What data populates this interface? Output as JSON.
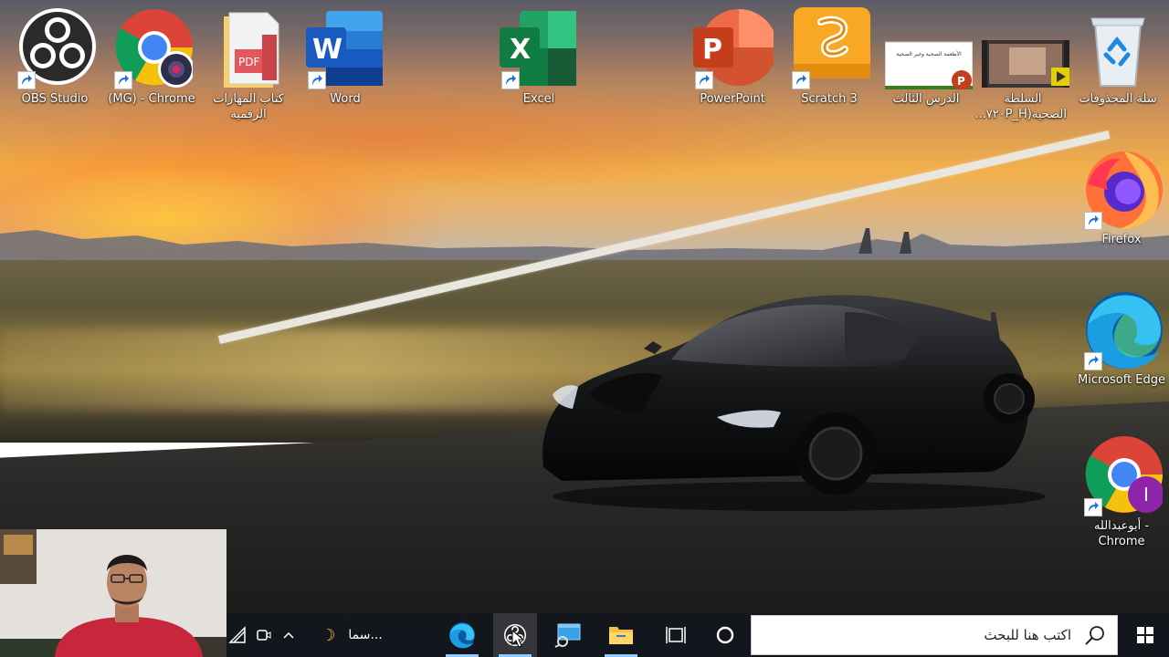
{
  "desktop": {
    "icons": [
      {
        "label": "OBS Studio",
        "icon": "obs-icon"
      },
      {
        "label": "(MG) - Chrome",
        "icon": "chrome-profile-icon"
      },
      {
        "label": "كتاب المهارات الرقميه",
        "icon": "pdf-folder-icon"
      },
      {
        "label": "Word",
        "icon": "word-icon"
      },
      {
        "label": "Excel",
        "icon": "excel-icon"
      },
      {
        "label": "PowerPoint",
        "icon": "powerpoint-icon"
      },
      {
        "label": "Scratch 3",
        "icon": "scratch-icon"
      },
      {
        "label": "الدرس الثالث",
        "icon": "powerpoint-file-icon",
        "thumb_text": "الأطعمة الصحية وغير الصحية"
      },
      {
        "label": "السلطة الصحية(٧٢٠P_H...",
        "icon": "video-file-icon"
      },
      {
        "label": "سلة المحذوفات",
        "icon": "recycle-bin-icon"
      },
      {
        "label": "Firefox",
        "icon": "firefox-icon"
      },
      {
        "label": "Microsoft Edge",
        "icon": "edge-icon"
      },
      {
        "label": "أبوعبدالله - Chrome",
        "icon": "chrome-profile-icon",
        "avatar_letter": "I"
      }
    ]
  },
  "taskbar": {
    "search_placeholder": "اكتب هنا للبحث",
    "weather_text": "سما...",
    "apps": [
      "edge-icon",
      "obs-icon",
      "remote-desktop-icon",
      "file-explorer-icon",
      "task-view-icon",
      "cortana-icon"
    ]
  },
  "colors": {
    "taskbar_bg": "#12161e",
    "active_indicator": "#8ec9ff",
    "word": "#2b5797",
    "excel": "#1d6f42",
    "powerpoint": "#c43e1c",
    "scratch": "#f9a825"
  }
}
